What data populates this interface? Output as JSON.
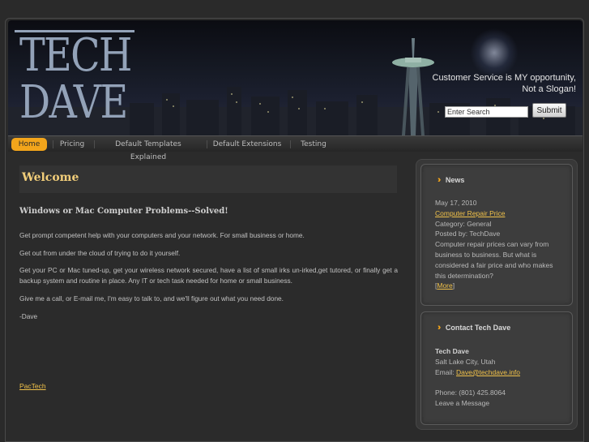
{
  "header": {
    "logo_line1": "TECH",
    "logo_line2": "DAVE",
    "tagline_line1": "Customer Service is MY opportunity,",
    "tagline_line2": "Not a Slogan!",
    "search_placeholder": "Enter Search",
    "search_button": "Submit"
  },
  "nav": {
    "items": [
      {
        "label": "Home",
        "active": true
      },
      {
        "label": "Pricing"
      },
      {
        "label": "Default Templates Explained"
      },
      {
        "label": "Default Extensions"
      },
      {
        "label": "Testing"
      }
    ]
  },
  "main": {
    "title": "Welcome",
    "subheading": "Windows or Mac Computer Problems--Solved!",
    "paragraphs": [
      "Get prompt competent help with your computers and your network. For small business or home.",
      "Get out from under the cloud of trying to do it yourself.",
      "Get your PC or Mac tuned-up, get your wireless network secured, have a list of small irks un-irked,get tutored, or finally get a backup system and routine in place. Any IT or tech task needed for home or small business.",
      "Give me a call, or E-mail me, I'm easy to talk to, and we'll figure out what you need done.",
      "-Dave"
    ],
    "footer_link": "PacTech"
  },
  "news": {
    "heading": "News",
    "date": "May 17, 2010",
    "article_link": "Computer Repair Price",
    "category": "Category: General",
    "posted_by": "Posted by: TechDave",
    "summary": "Computer repair prices can vary from business to business. But what is considered a fair price and who makes this determination?",
    "more_open": "[",
    "more_link": "More",
    "more_close": "]"
  },
  "contact": {
    "heading": "Contact Tech Dave",
    "name": "Tech Dave",
    "location": "Salt Lake City, Utah",
    "email_label": "Email: ",
    "email": "Dave@techdave.info",
    "phone": "Phone: (801) 425.8064",
    "leave_message": "Leave a Message"
  },
  "colors": {
    "accent": "#f3a51b",
    "link": "#f0c14a",
    "title": "#f2ce7a",
    "background": "#2a2a2a"
  },
  "icons": {
    "news": "double-chevron-right-icon",
    "contact": "double-chevron-right-icon"
  }
}
